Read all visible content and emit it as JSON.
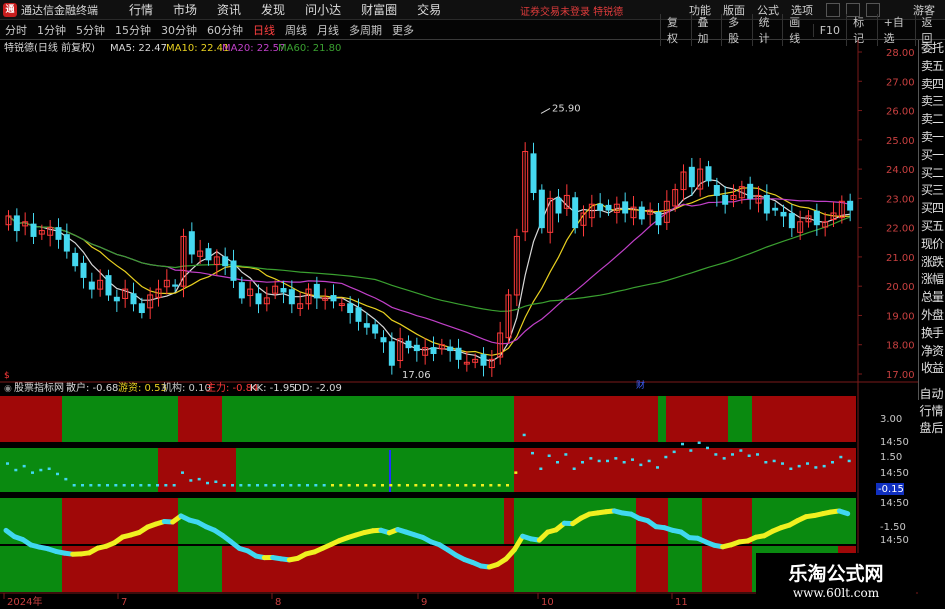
{
  "app": {
    "logo_glyph": "通",
    "title": "通达信金融终端",
    "warning": "证券交易未登录  特锐德"
  },
  "menu": [
    "行情",
    "市场",
    "资讯",
    "发现",
    "问小达",
    "财富圈",
    "交易"
  ],
  "top_right": [
    "功能",
    "版面",
    "公式",
    "选项"
  ],
  "guest": "游客",
  "periods": [
    "分时",
    "1分钟",
    "5分钟",
    "15分钟",
    "30分钟",
    "60分钟",
    "日线",
    "周线",
    "月线",
    "多周期",
    "更多"
  ],
  "active_period": "日线",
  "toolbar_right": [
    "复权",
    "叠加",
    "多股",
    "统计",
    "画线",
    "F10",
    "标记",
    "+自选",
    "返回"
  ],
  "main_legend": {
    "stock": "特锐德(日线 前复权)",
    "ma5": "MA5: 22.47",
    "ma10": "MA10: 22.41",
    "ma20": "MA20: 22.57",
    "ma60": "MA60: 21.80"
  },
  "sub_legend": {
    "name": "股票指标网",
    "retail": "散户: -0.68",
    "hot": "游资: 0.53",
    "inst": "机构: 0.10",
    "main": "主力: -0.84",
    "kk": "KK: -1.95",
    "dd": "DD: -2.09"
  },
  "annotations": {
    "high": "25.90",
    "low": "17.06",
    "marker1": "财",
    "marker2": "$"
  },
  "price_axis": [
    "28.00",
    "27.00",
    "26.00",
    "25.00",
    "24.00",
    "23.00",
    "22.00",
    "21.00",
    "20.00",
    "19.00",
    "18.00",
    "17.00"
  ],
  "sub_axis": [
    "3.00",
    "14:50",
    "1.50",
    "14:50",
    "-0.15",
    "14:50",
    "-1.50",
    "14:50"
  ],
  "x_axis": [
    "2024年",
    "7",
    "8",
    "9",
    "10",
    "11"
  ],
  "vtabs": [
    "委托",
    "卖五",
    "卖四",
    "卖三",
    "卖二",
    "卖一",
    "买一",
    "买二",
    "买三",
    "买四",
    "买五",
    "现价",
    "涨跌",
    "涨幅",
    "总量",
    "外盘",
    "换手",
    "净资",
    "收益"
  ],
  "vtabs2": [
    "自动",
    "行情",
    "盘后"
  ],
  "watermark": {
    "line1": "乐淘公式网",
    "line2": "www.60lt.com"
  },
  "colors": {
    "up": "#ff3a3a",
    "down": "#45d8f0",
    "ma5": "#d8d8d8",
    "ma10": "#e8d020",
    "ma20": "#c040c8",
    "ma60": "#3aa030",
    "green_zone": "#0a8a10",
    "red_zone": "#a00808",
    "cyan_line": "#40d8f0",
    "yellow_line": "#f0f020"
  },
  "chart_data": {
    "type": "candlestick",
    "closes": [
      22.4,
      21.9,
      22.2,
      21.7,
      21.9,
      22.0,
      21.6,
      21.2,
      20.7,
      20.3,
      19.9,
      20.2,
      19.7,
      19.5,
      19.9,
      19.4,
      19.1,
      19.7,
      19.9,
      20.2,
      20.0,
      21.7,
      21.1,
      21.2,
      20.9,
      21.0,
      20.7,
      20.2,
      19.6,
      19.9,
      19.4,
      19.6,
      20.0,
      19.8,
      19.4,
      19.4,
      19.9,
      19.6,
      19.6,
      19.5,
      19.4,
      19.1,
      18.8,
      18.6,
      18.4,
      18.1,
      17.3,
      18.2,
      17.9,
      17.8,
      17.9,
      17.7,
      18.0,
      17.8,
      17.5,
      17.4,
      17.5,
      17.3,
      17.5,
      18.4,
      19.7,
      21.7,
      24.6,
      23.2,
      22.0,
      23.0,
      22.5,
      23.1,
      22.0,
      22.5,
      22.8,
      22.6,
      22.6,
      22.8,
      22.5,
      22.7,
      22.3,
      22.6,
      22.1,
      22.9,
      23.3,
      23.9,
      23.4,
      24.0,
      23.6,
      23.1,
      22.8,
      23.1,
      23.4,
      23.0,
      23.1,
      22.5,
      22.6,
      22.4,
      22.0,
      22.2,
      22.4,
      22.1,
      22.2,
      22.5,
      22.9,
      22.6
    ],
    "ma5": "22.47",
    "ma10": "22.41",
    "ma20": "22.57",
    "ma60": "21.80",
    "y_range": [
      17,
      28
    ],
    "high_label": 25.9,
    "low_label": 17.06
  }
}
